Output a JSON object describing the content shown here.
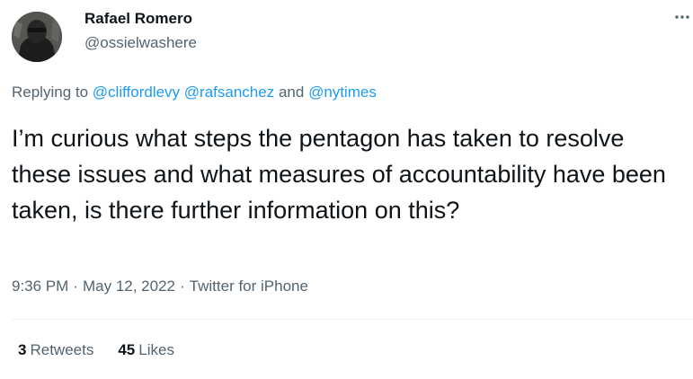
{
  "author": {
    "name": "Rafael Romero",
    "handle": "@ossielwashere"
  },
  "reply": {
    "prefix": "Replying to",
    "mentions": [
      "@cliffordlevy",
      "@rafsanchez",
      "@nytimes"
    ],
    "joiner": "and"
  },
  "tweet": {
    "text": "I’m curious what steps the pentagon has taken to resolve these issues and what measures of accountability have been taken, is there further information on this?"
  },
  "meta": {
    "time": "9:36 PM",
    "separator": "·",
    "date": "May 12, 2022",
    "source": "Twitter for iPhone"
  },
  "stats": {
    "retweets_count": "3",
    "retweets_label": "Retweets",
    "likes_count": "45",
    "likes_label": "Likes"
  },
  "icons": {
    "more": "more-horizontal-icon",
    "avatar": "user-avatar"
  },
  "colors": {
    "text_primary": "#0f1419",
    "text_secondary": "#536471",
    "link": "#1d9bf0",
    "divider": "#eff3f4"
  }
}
